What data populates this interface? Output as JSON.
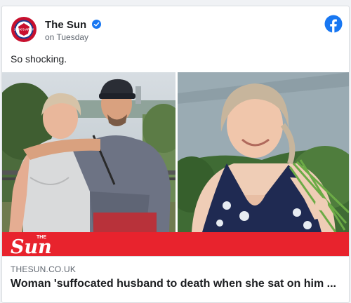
{
  "post": {
    "page_name": "The Sun",
    "timestamp": "on Tuesday",
    "text": "So shocking.",
    "verified_icon": "verified-badge-icon",
    "platform_icon": "facebook-icon"
  },
  "avatar": {
    "badge_text": "JACK'S ARMY",
    "colors": {
      "ring": "#c8102e",
      "inner": "#1d3c8f"
    }
  },
  "banner": {
    "logo_word": "Sun",
    "logo_small": "THE",
    "color": "#e8232d"
  },
  "link": {
    "domain": "THESUN.CO.UK",
    "headline": "Woman 'suffocated husband to death when she sat on him ..."
  },
  "colors": {
    "facebook_blue": "#1877f2",
    "sun_red": "#e8232d"
  }
}
